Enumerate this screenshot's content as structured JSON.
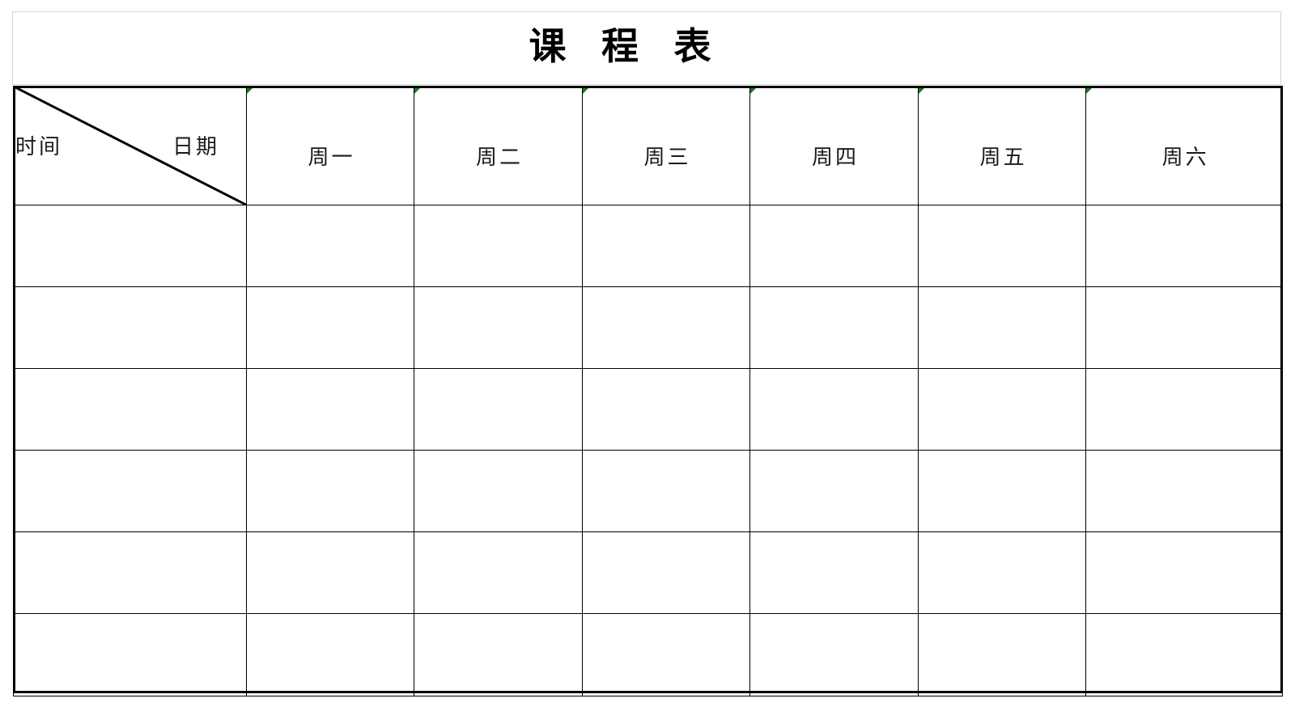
{
  "document": {
    "title": "课 程 表",
    "title_plain": "课程表"
  },
  "table": {
    "corner": {
      "row_label": "时间",
      "col_label": "日期",
      "diagonal": "top-left-to-bottom-right"
    },
    "columns": [
      {
        "label": "周一",
        "flag": "green-comment-triangle"
      },
      {
        "label": "周二",
        "flag": "green-comment-triangle"
      },
      {
        "label": "周三",
        "flag": "green-comment-triangle"
      },
      {
        "label": "周四",
        "flag": "green-comment-triangle"
      },
      {
        "label": "周五",
        "flag": "green-comment-triangle"
      },
      {
        "label": "周六",
        "flag": "green-comment-triangle"
      }
    ],
    "rows": [
      {
        "time": "",
        "cells": [
          "",
          "",
          "",
          "",
          "",
          ""
        ]
      },
      {
        "time": "",
        "cells": [
          "",
          "",
          "",
          "",
          "",
          ""
        ]
      },
      {
        "time": "",
        "cells": [
          "",
          "",
          "",
          "",
          "",
          ""
        ]
      },
      {
        "time": "",
        "cells": [
          "",
          "",
          "",
          "",
          "",
          ""
        ]
      },
      {
        "time": "",
        "cells": [
          "",
          "",
          "",
          "",
          "",
          ""
        ]
      },
      {
        "time": "",
        "cells": [
          "",
          "",
          "",
          "",
          "",
          ""
        ]
      }
    ]
  },
  "colors": {
    "grid": "#000000",
    "text": "#1a1a1a",
    "title_box_border": "#d4d4d4",
    "comment_flag": "#167d16",
    "background": "#ffffff"
  }
}
